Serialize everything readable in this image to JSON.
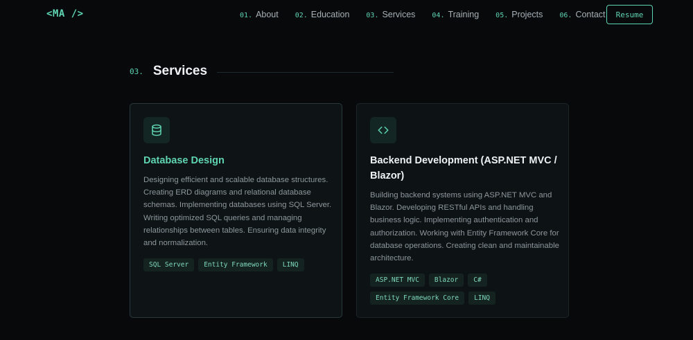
{
  "nav": {
    "logo": "<MA />",
    "items": [
      {
        "num": "01.",
        "label": "About"
      },
      {
        "num": "02.",
        "label": "Education"
      },
      {
        "num": "03.",
        "label": "Services"
      },
      {
        "num": "04.",
        "label": "Training"
      },
      {
        "num": "05.",
        "label": "Projects"
      },
      {
        "num": "06.",
        "label": "Contact"
      }
    ],
    "resume_label": "Resume"
  },
  "section": {
    "num": "03.",
    "title": "Services"
  },
  "cards": [
    {
      "icon": "database-icon",
      "title": "Database Design",
      "description": "Designing efficient and scalable database structures. Creating ERD diagrams and relational database schemas. Implementing databases using SQL Server. Writing optimized SQL queries and managing relationships between tables. Ensuring data integrity and normalization.",
      "tags": [
        "SQL Server",
        "Entity Framework",
        "LINQ"
      ]
    },
    {
      "icon": "code-icon",
      "title": "Backend Development (ASP.NET MVC / Blazor)",
      "description": "Building backend systems using ASP.NET MVC and Blazor. Developing RESTful APIs and handling business logic. Implementing authentication and authorization. Working with Entity Framework Core for database operations. Creating clean and maintainable architecture.",
      "tags": [
        "ASP.NET MVC",
        "Blazor",
        "C#",
        "Entity Framework Core",
        "LINQ"
      ]
    }
  ],
  "colors": {
    "accent": "#5fd4b0",
    "background": "#07090b",
    "card": "#0d1215",
    "text_muted": "#8e979d"
  }
}
